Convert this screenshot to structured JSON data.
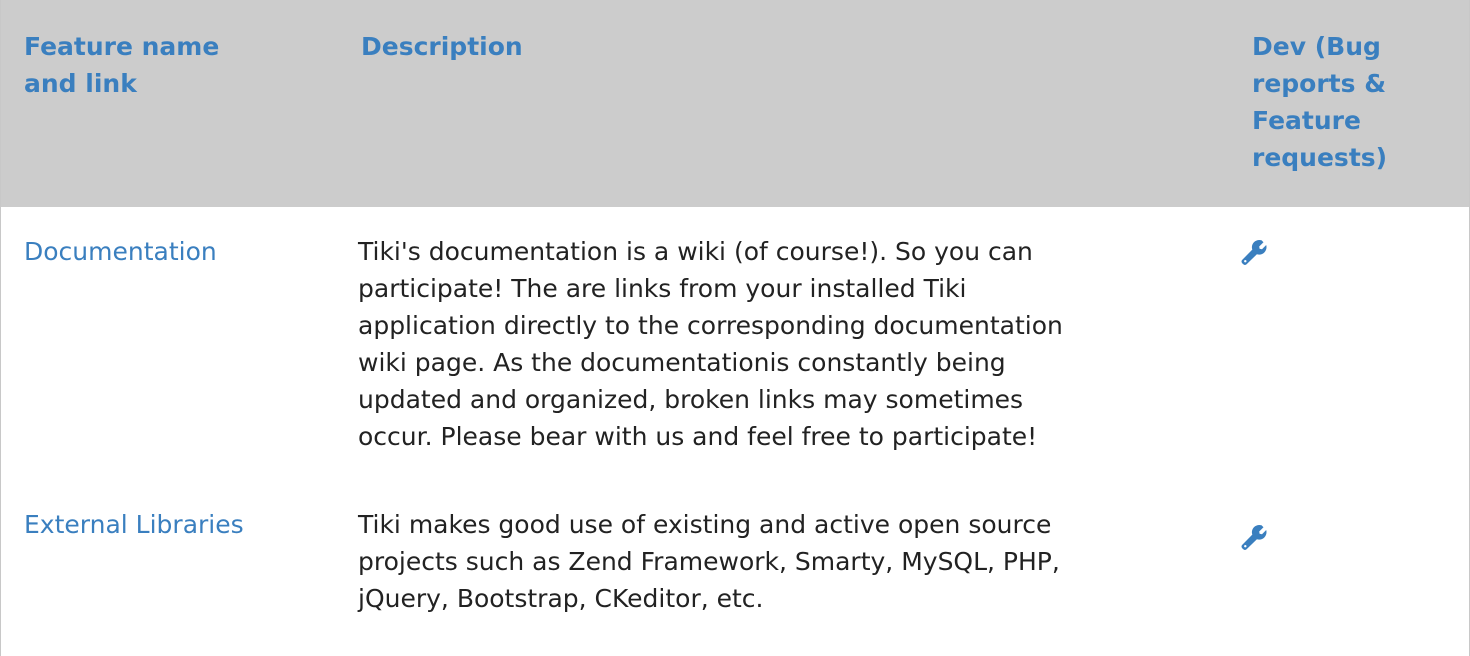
{
  "table": {
    "headers": {
      "feature": "Feature name and link",
      "description": "Description",
      "dev": "Dev (Bug reports & Feature requests)"
    },
    "rows": [
      {
        "feature": "Documentation",
        "description": "Tiki's documentation is a wiki (of course!). So you can participate! The are links from your installed Tiki application directly to the corresponding documentation wiki page. As the documentationis constantly being updated and organized, broken links may sometimes occur. Please bear with us and feel free to participate!",
        "dev_icon": "wrench-icon"
      },
      {
        "feature": "External Libraries",
        "description": "Tiki makes good use of existing and active open source projects such as Zend Framework, Smarty, MySQL, PHP, jQuery, Bootstrap, CKeditor, etc.",
        "dev_icon": "wrench-icon"
      }
    ]
  },
  "colors": {
    "link": "#3a7fbf",
    "header_bg": "#cccccc",
    "text": "#222222"
  }
}
